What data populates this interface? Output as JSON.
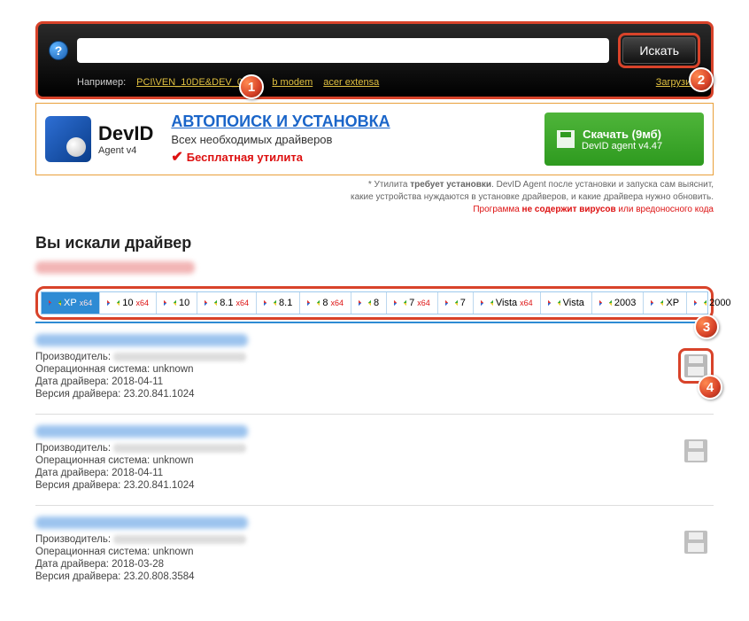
{
  "search": {
    "help_glyph": "?",
    "placeholder": "",
    "button_label": "Искать",
    "example_label": "Например:",
    "examples": [
      "PCI\\VEN_10DE&DEV_0CA3",
      "b modem",
      "acer extensa"
    ],
    "download_link": "Загрузить"
  },
  "promo": {
    "logo_title": "DevID",
    "logo_sub": "Agent v4",
    "headline": "АВТОПОИСК И УСТАНОВКА",
    "line2": "Всех необходимых драйверов",
    "free_label": "Бесплатная утилита",
    "btn_line1": "Скачать (9мб)",
    "btn_line2": "DevID agent v4.47",
    "note_line1a": "* Утилита ",
    "note_line1b": "требует установки",
    "note_line1c": ". DevID Agent после установки и запуска сам выяснит,",
    "note_line2": "какие устройства нуждаются в установке драйверов, и какие драйвера нужно обновить.",
    "note_line3a": "Программа ",
    "note_line3b": "не содержит вирусов",
    "note_line3c": " или вредоносного кода"
  },
  "results": {
    "heading": "Вы искали драйвер",
    "os_tabs": [
      {
        "label": "XP",
        "x64": true,
        "active": true
      },
      {
        "label": "10",
        "x64": true
      },
      {
        "label": "10",
        "x64": false
      },
      {
        "label": "8.1",
        "x64": true
      },
      {
        "label": "8.1",
        "x64": false
      },
      {
        "label": "8",
        "x64": true
      },
      {
        "label": "8",
        "x64": false
      },
      {
        "label": "7",
        "x64": true
      },
      {
        "label": "7",
        "x64": false
      },
      {
        "label": "Vista",
        "x64": true
      },
      {
        "label": "Vista",
        "x64": false
      },
      {
        "label": "2003",
        "x64": false
      },
      {
        "label": "XP",
        "x64": false
      },
      {
        "label": "2000",
        "x64": false
      }
    ],
    "labels": {
      "manufacturer": "Производитель:",
      "os": "Операционная система:",
      "date": "Дата драйвера:",
      "version": "Версия драйвера:"
    },
    "items": [
      {
        "os": "unknown",
        "date": "2018-04-11",
        "version": "23.20.841.1024",
        "highlight": true
      },
      {
        "os": "unknown",
        "date": "2018-04-11",
        "version": "23.20.841.1024",
        "highlight": false
      },
      {
        "os": "unknown",
        "date": "2018-03-28",
        "version": "23.20.808.3584",
        "highlight": false
      }
    ]
  },
  "markers": {
    "m1": "1",
    "m2": "2",
    "m3": "3",
    "m4": "4"
  }
}
